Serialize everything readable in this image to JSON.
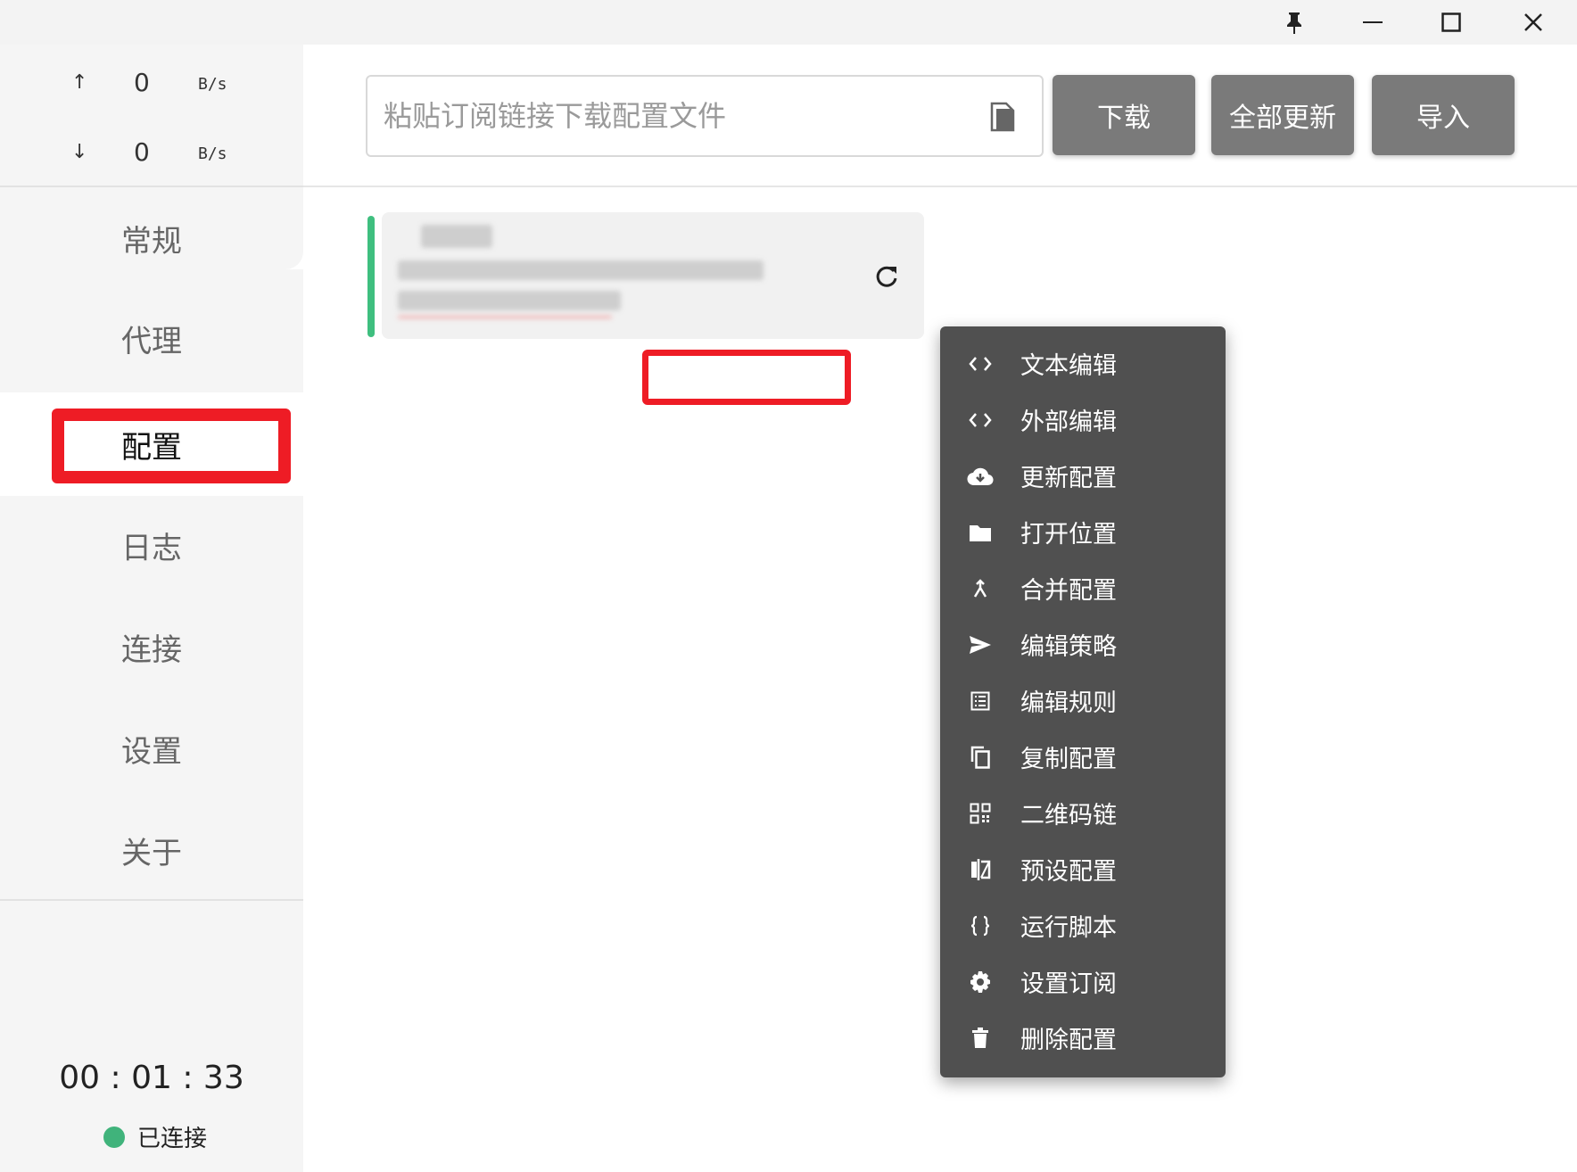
{
  "titlebar": {
    "icons": [
      "pin-icon",
      "minimize-icon",
      "maximize-icon",
      "close-icon"
    ]
  },
  "traffic": {
    "up_arrow": "↑",
    "up_value": "0",
    "up_unit": "B/s",
    "down_arrow": "↓",
    "down_value": "0",
    "down_unit": "B/s"
  },
  "nav": {
    "items": [
      {
        "label": "常规"
      },
      {
        "label": "代理"
      },
      {
        "label": "配置"
      },
      {
        "label": "日志"
      },
      {
        "label": "连接"
      },
      {
        "label": "设置"
      },
      {
        "label": "关于"
      }
    ],
    "active_index": 2
  },
  "footer": {
    "timer": "00 : 01 : 33",
    "status": "已连接",
    "status_color": "#40b37b"
  },
  "toolbar": {
    "url_placeholder": "粘贴订阅链接下载配置文件",
    "url_value": "",
    "download_label": "下载",
    "update_all_label": "全部更新",
    "import_label": "导入"
  },
  "profile_card": {
    "accent_color": "#3fbf7f",
    "content_redacted": true
  },
  "context_menu": {
    "items": [
      {
        "label": "文本编辑",
        "icon": "code-icon"
      },
      {
        "label": "外部编辑",
        "icon": "code-icon"
      },
      {
        "label": "更新配置",
        "icon": "cloud-download-icon"
      },
      {
        "label": "打开位置",
        "icon": "folder-icon"
      },
      {
        "label": "合并配置",
        "icon": "merge-icon"
      },
      {
        "label": "编辑策略",
        "icon": "send-icon"
      },
      {
        "label": "编辑规则",
        "icon": "list-icon"
      },
      {
        "label": "复制配置",
        "icon": "copy-icon"
      },
      {
        "label": "二维码链",
        "icon": "qrcode-icon"
      },
      {
        "label": "预设配置",
        "icon": "compare-icon"
      },
      {
        "label": "运行脚本",
        "icon": "braces-icon"
      },
      {
        "label": "设置订阅",
        "icon": "gear-icon"
      },
      {
        "label": "删除配置",
        "icon": "trash-icon"
      }
    ]
  },
  "highlight_color": "#ee1c25"
}
